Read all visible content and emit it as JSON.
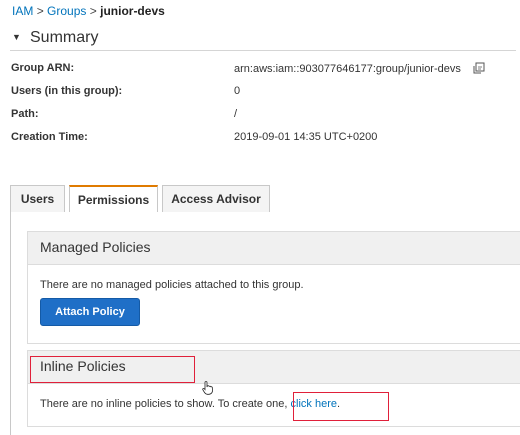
{
  "breadcrumb": {
    "root": "IAM",
    "sep1": ">",
    "parent": "Groups",
    "sep2": ">",
    "current": "junior-devs"
  },
  "summary": {
    "title": "Summary",
    "fields": [
      {
        "label": "Group ARN:",
        "value": "arn:aws:iam::903077646177:group/junior-devs"
      },
      {
        "label": "Users (in this group):",
        "value": "0"
      },
      {
        "label": "Path:",
        "value": "/"
      },
      {
        "label": "Creation Time:",
        "value": "2019-09-01 14:35 UTC+0200"
      }
    ]
  },
  "tabs": [
    {
      "label": "Users",
      "active": false
    },
    {
      "label": "Permissions",
      "active": true
    },
    {
      "label": "Access Advisor",
      "active": false
    }
  ],
  "managed": {
    "title": "Managed Policies",
    "message": "There are no managed policies attached to this group.",
    "button": "Attach Policy"
  },
  "inline": {
    "title": "Inline Policies",
    "message_pre": "There are no inline policies to show. To create one,",
    "link": "click here",
    "message_post": "."
  },
  "colors": {
    "link": "#0073bb",
    "primary_button": "#1f6fc7",
    "active_tab_accent": "#e07b00",
    "annotation_box": "#e0203a"
  },
  "icons": {
    "copy": "copy-icon",
    "caret": "caret-down-icon",
    "cursor": "hand-pointer-cursor-icon"
  }
}
